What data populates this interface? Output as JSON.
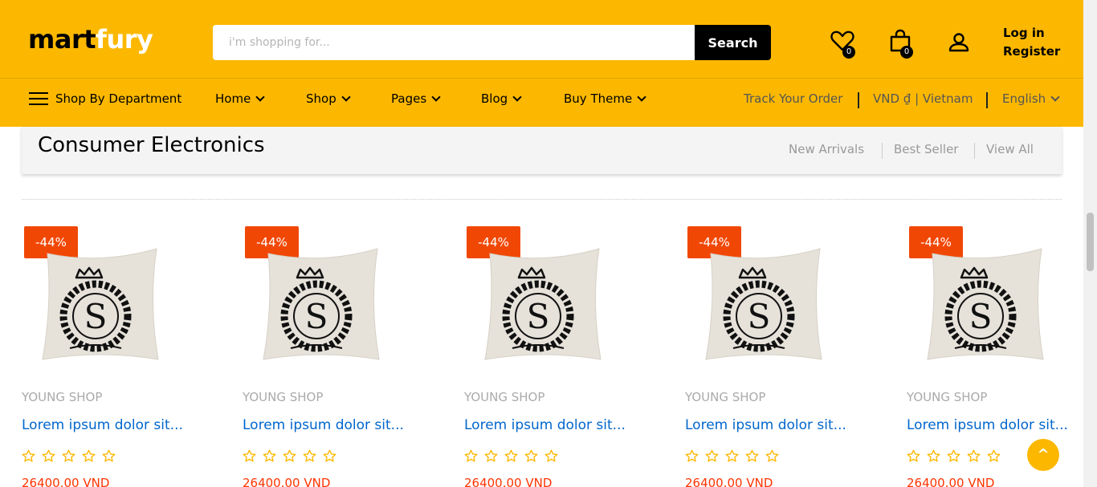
{
  "header": {
    "logo_main": "mart",
    "logo_accent": "fury",
    "search_placeholder": "i'm shopping for...",
    "search_button": "Search",
    "wishlist_count": "0",
    "cart_count": "0",
    "login_label": "Log in",
    "register_label": "Register"
  },
  "nav": {
    "department_label": "Shop By Department",
    "items": [
      "Home",
      "Shop",
      "Pages",
      "Blog",
      "Buy Theme"
    ],
    "track_order": "Track Your Order",
    "currency": "VND ₫ | Vietnam",
    "language": "English"
  },
  "section": {
    "title": "Consumer Electronics",
    "links": [
      "New Arrivals",
      "Best Seller",
      "View All"
    ]
  },
  "products": [
    {
      "discount": "-44%",
      "shop": "YOUNG SHOP",
      "title": "Lorem ipsum dolor sit...",
      "rating": 0,
      "price": "26400.00 VND"
    },
    {
      "discount": "-44%",
      "shop": "YOUNG SHOP",
      "title": "Lorem ipsum dolor sit...",
      "rating": 0,
      "price": "26400.00 VND"
    },
    {
      "discount": "-44%",
      "shop": "YOUNG SHOP",
      "title": "Lorem ipsum dolor sit...",
      "rating": 0,
      "price": "26400.00 VND"
    },
    {
      "discount": "-44%",
      "shop": "YOUNG SHOP",
      "title": "Lorem ipsum dolor sit...",
      "rating": 0,
      "price": "26400.00 VND"
    },
    {
      "discount": "-44%",
      "shop": "YOUNG SHOP",
      "title": "Lorem ipsum dolor sit...",
      "rating": 0,
      "price": "26400.00 VND"
    }
  ],
  "back_to_top": "^",
  "colors": {
    "brand": "#fcb800",
    "discount": "#f14705",
    "link": "#0066cc",
    "price": "#ff3300"
  }
}
